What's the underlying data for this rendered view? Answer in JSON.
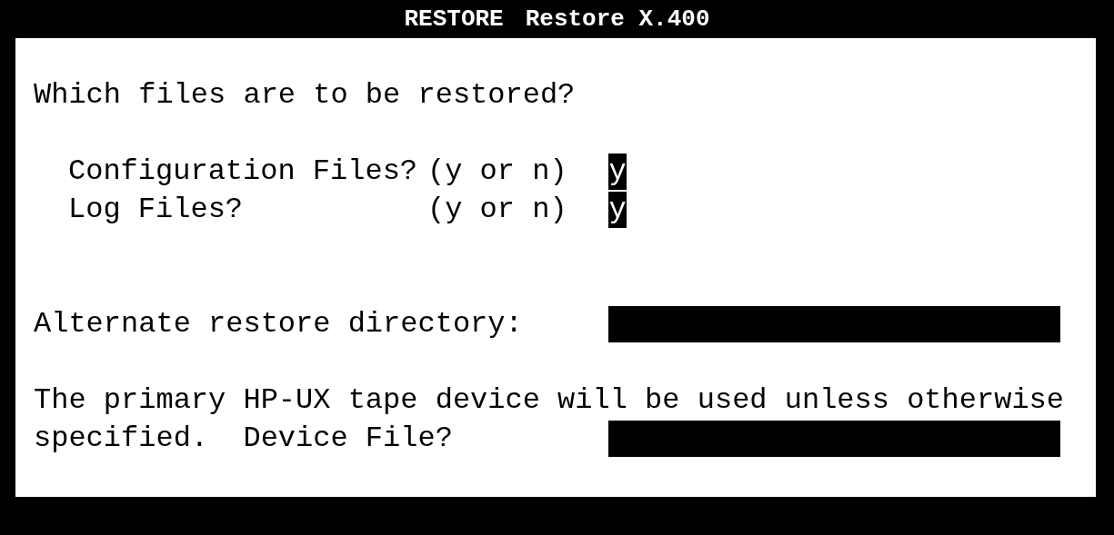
{
  "window": {
    "title": "RESTORE",
    "subtitle": "Restore X.400"
  },
  "question": "Which files are to be restored?",
  "file_options": [
    {
      "label": "Configuration Files?",
      "hint": "(y or n)",
      "value": "y"
    },
    {
      "label": "Log Files?",
      "hint": "(y or n)",
      "value": "y"
    }
  ],
  "alternate_directory": {
    "label": "Alternate restore directory:"
  },
  "device_note": "The primary HP-UX tape device will be used unless otherwise",
  "device_file": {
    "label": "specified.  Device File?"
  }
}
